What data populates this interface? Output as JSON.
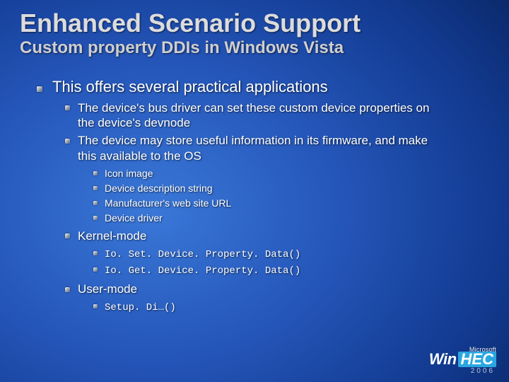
{
  "title": "Enhanced Scenario Support",
  "subtitle": "Custom property DDIs in Windows Vista",
  "main": {
    "heading": "This offers several practical applications",
    "points": [
      "The device's bus driver can set these custom device properties on the device's devnode",
      "The device may store useful information in its firmware, and make this available to the OS"
    ],
    "examples": [
      "Icon image",
      "Device description string",
      "Manufacturer's web site URL",
      "Device driver"
    ],
    "kernel": {
      "label": "Kernel-mode",
      "items": [
        "Io. Set. Device. Property. Data()",
        "Io. Get. Device. Property. Data()"
      ]
    },
    "user": {
      "label": "User-mode",
      "items": [
        "Setup. Di…()"
      ]
    }
  },
  "logo": {
    "top": "Microsoft",
    "brand1": "Win",
    "brand2": "HEC",
    "year": "2006"
  }
}
